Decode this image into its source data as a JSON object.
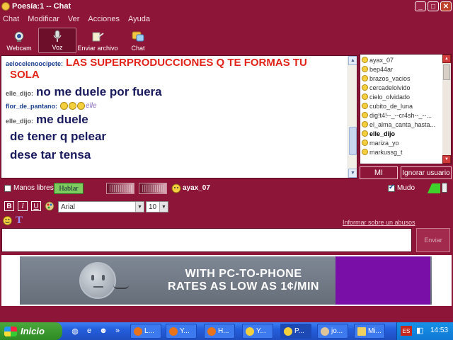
{
  "window": {
    "title": "Poesía:1 -- Chat",
    "controls": [
      "_",
      "□",
      "✕"
    ]
  },
  "menu": [
    "Chat",
    "Modificar",
    "Ver",
    "Acciones",
    "Ayuda"
  ],
  "toolbar": [
    {
      "label": "Webcam",
      "icon": "webcam-icon"
    },
    {
      "label": "Voz",
      "icon": "microphone-icon"
    },
    {
      "label": "Enviar archivo",
      "icon": "send-file-icon"
    },
    {
      "label": "Chat",
      "icon": "chat-icon"
    }
  ],
  "messages": [
    {
      "nick": "aelocelenoocipete:",
      "text": "LAS SUPERPRODUCCIONES Q TE FORMAS TU",
      "cont": "SOLA"
    },
    {
      "nick": "elle_dijo:",
      "text": "no me duele por fuera"
    },
    {
      "nick": "flor_de_pantano:",
      "text": "elle"
    },
    {
      "nick": "elle_dijo:",
      "text": "me duele"
    },
    {
      "cont": "de tener q pelear"
    },
    {
      "cont": "dese tar tensa"
    }
  ],
  "users": [
    "ayax_07",
    "bep44ar",
    "brazos_vacios",
    "cercadelolvido",
    "cielo_olvidado",
    "cubito_de_luna",
    "dig!t4!--_--cr4sh--_--...",
    "el_alma_canta_hasta...",
    "elle_dijo",
    "mariza_yo",
    "markussg_t"
  ],
  "user_bold": "elle_dijo",
  "buttons": {
    "mi": "MI",
    "ignore": "Ignorar usuario",
    "talk": "Hablar",
    "send": "Enviar"
  },
  "voice": {
    "hands_free": "Manos libres",
    "speaker": "ayax_07",
    "mute": "Mudo"
  },
  "format": {
    "bold": "B",
    "italic": "I",
    "underline": "U",
    "font": "Arial",
    "size": "10"
  },
  "report_link": "Informar sobre un abusos",
  "input": {
    "value": ""
  },
  "ad": {
    "line1": "WITH PC-TO-PHONE",
    "line2": "RATES AS LOW AS 1¢/MIN"
  },
  "taskbar": {
    "start": "Inicio",
    "tasks": [
      "L...",
      "Y...",
      "H...",
      "Y...",
      "P...",
      "jo...",
      "Mi..."
    ],
    "lang": "ES",
    "clock": "14:53"
  }
}
